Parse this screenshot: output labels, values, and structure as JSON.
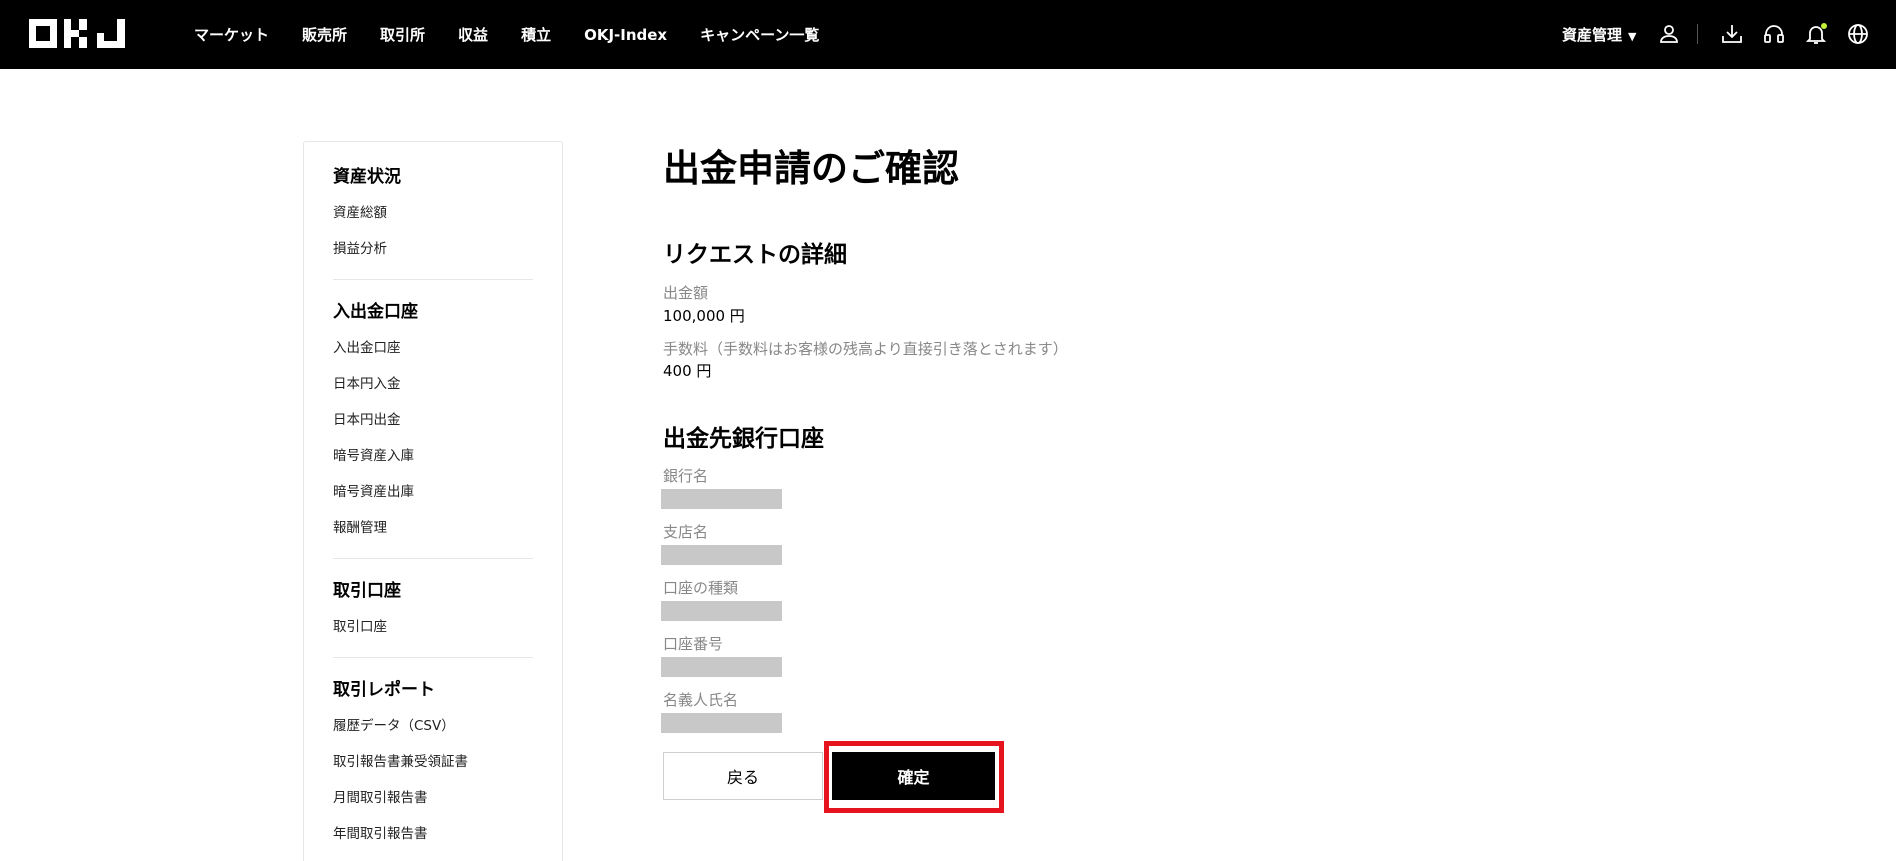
{
  "brand": {
    "logo_text": "OKJ"
  },
  "nav": {
    "items": [
      {
        "label": "マーケット"
      },
      {
        "label": "販売所"
      },
      {
        "label": "取引所"
      },
      {
        "label": "収益"
      },
      {
        "label": "積立"
      },
      {
        "label": "OKJ-Index"
      },
      {
        "label": "キャンペーン一覧"
      }
    ],
    "asset_menu_label": "資産管理",
    "notification_dot_color": "#c5f03a"
  },
  "sidebar": {
    "sections": [
      {
        "heading": "資産状況",
        "links": [
          "資産総額",
          "損益分析"
        ]
      },
      {
        "heading": "入出金口座",
        "links": [
          "入出金口座",
          "日本円入金",
          "日本円出金",
          "暗号資産入庫",
          "暗号資産出庫",
          "報酬管理"
        ]
      },
      {
        "heading": "取引口座",
        "links": [
          "取引口座"
        ]
      },
      {
        "heading": "取引レポート",
        "links": [
          "履歴データ（CSV）",
          "取引報告書兼受領証書",
          "月間取引報告書",
          "年間取引報告書"
        ]
      }
    ]
  },
  "main": {
    "title": "出金申請のご確認",
    "request_section": {
      "title": "リクエストの詳細",
      "amount_label": "出金額",
      "amount_value": "100,000 円",
      "fee_label": "手数料（手数料はお客様の残高より直接引き落とされます）",
      "fee_value": "400 円"
    },
    "bank_section": {
      "title": "出金先銀行口座",
      "fields": [
        {
          "label": "銀行名"
        },
        {
          "label": "支店名"
        },
        {
          "label": "口座の種類"
        },
        {
          "label": "口座番号"
        },
        {
          "label": "名義人氏名"
        }
      ]
    },
    "buttons": {
      "back_label": "戻る",
      "confirm_label": "確定"
    },
    "highlight_color": "#e5141e"
  }
}
